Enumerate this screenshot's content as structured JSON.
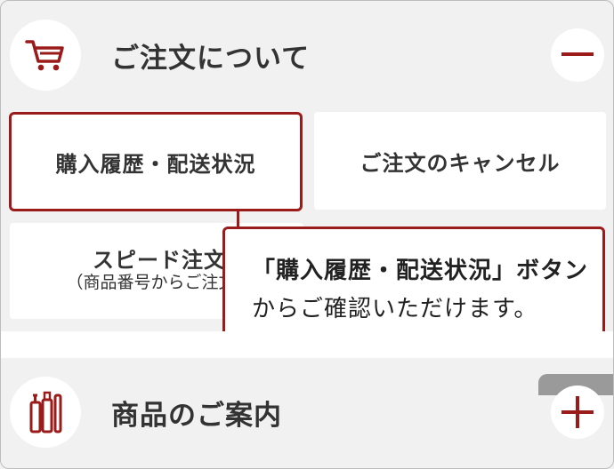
{
  "colors": {
    "accent": "#9b1b1b",
    "background": "#f1f1f1",
    "card": "#ffffff",
    "text": "#333333"
  },
  "order_section": {
    "icon": "cart-icon",
    "title": "ご注文について",
    "toggle_icon": "minus-icon",
    "buttons": {
      "history": "購入履歴・配送状況",
      "cancel": "ご注文のキャンセル",
      "speed_main": "スピード注文",
      "speed_sub": "（商品番号からご注文）"
    }
  },
  "callout": {
    "line1": "「購入履歴・配送状況」ボタン",
    "line2": "からご確認いただけます。"
  },
  "product_section": {
    "icon": "bottles-icon",
    "title": "商品のご案内",
    "toggle_icon": "plus-icon"
  }
}
